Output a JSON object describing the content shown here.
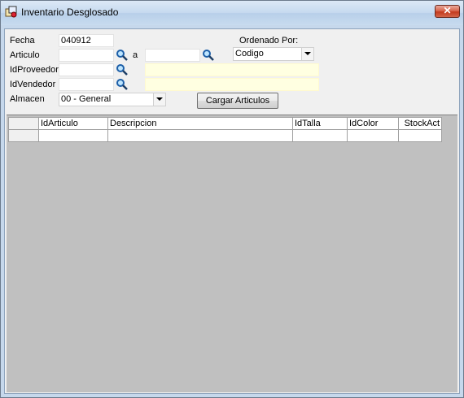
{
  "window": {
    "title": "Inventario Desglosado",
    "close_label": "✕"
  },
  "form": {
    "fecha_label": "Fecha",
    "fecha_value": "040912",
    "articulo_label": "Articulo",
    "articulo_from": "",
    "a_label": "a",
    "articulo_to": "",
    "idproveedor_label": "IdProveedor",
    "idproveedor_value": "",
    "idproveedor_name": "",
    "idvendedor_label": "IdVendedor",
    "idvendedor_value": "",
    "idvendedor_name": "",
    "almacen_label": "Almacen",
    "almacen_value": "00 - General",
    "ordenado_label": "Ordenado Por:",
    "ordenado_value": "Codigo",
    "cargar_button": "Cargar Articulos"
  },
  "grid": {
    "columns": [
      "IdArticulo",
      "Descripcion",
      "IdTalla",
      "IdColor",
      "StockAct"
    ],
    "rows": [
      [
        "",
        "",
        "",
        "",
        ""
      ]
    ]
  },
  "icons": [
    "app-icon",
    "search-icon",
    "chevron-down-icon",
    "close-icon"
  ]
}
